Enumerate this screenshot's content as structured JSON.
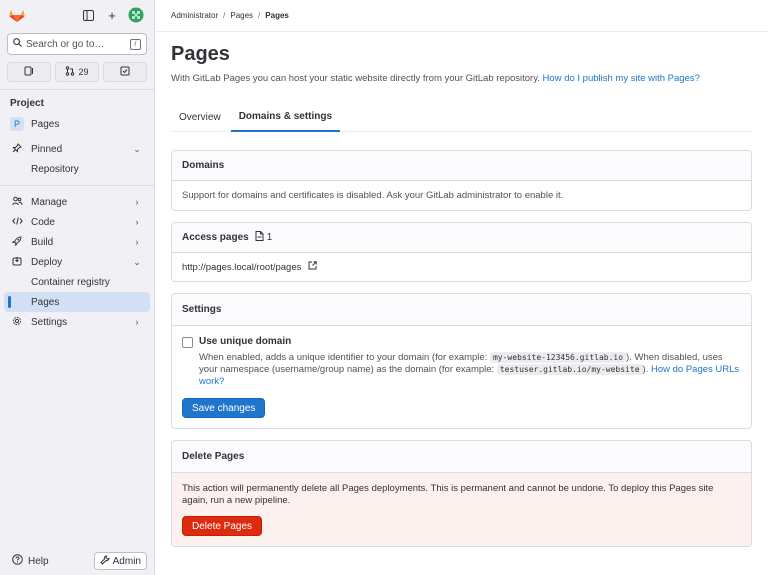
{
  "sidebar": {
    "search_label": "Search or go to…",
    "search_shortcut": "/",
    "merge_requests_count": "29",
    "project_heading": "Project",
    "project_badge": "P",
    "project_name": "Pages",
    "pinned_label": "Pinned",
    "pinned_items": [
      "Repository"
    ],
    "items": [
      {
        "label": "Manage",
        "icon": "users-icon"
      },
      {
        "label": "Code",
        "icon": "code-icon"
      },
      {
        "label": "Build",
        "icon": "rocket-icon"
      },
      {
        "label": "Deploy",
        "icon": "deploy-icon"
      }
    ],
    "deploy_sub": [
      "Container registry",
      "Pages"
    ],
    "settings_label": "Settings",
    "help_label": "Help",
    "admin_label": "Admin"
  },
  "breadcrumb": [
    "Administrator",
    "Pages",
    "Pages"
  ],
  "page": {
    "title": "Pages",
    "description": "With GitLab Pages you can host your static website directly from your GitLab repository.",
    "description_link": "How do I publish my site with Pages?"
  },
  "tabs": [
    "Overview",
    "Domains & settings"
  ],
  "domains": {
    "title": "Domains",
    "body": "Support for domains and certificates is disabled. Ask your GitLab administrator to enable it."
  },
  "access": {
    "title": "Access pages",
    "count": "1",
    "url": "http://pages.local/root/pages"
  },
  "settings": {
    "title": "Settings",
    "checkbox_label": "Use unique domain",
    "help_1": "When enabled, adds a unique identifier to your domain (for example:",
    "code_1": "my-website-123456.gitlab.io",
    "help_2": "). When disabled, uses your namespace (username/group name) as the domain (for example:",
    "code_2": "testuser.gitlab.io/my-website",
    "help_3": ").",
    "help_link": "How do Pages URLs work?",
    "save_label": "Save changes"
  },
  "delete": {
    "title": "Delete Pages",
    "body": "This action will permanently delete all Pages deployments. This is permanent and cannot be undone. To deploy this Pages site again, run a new pipeline.",
    "button_label": "Delete Pages"
  },
  "colors": {
    "accent": "#1f75cb",
    "danger": "#dd2b0e",
    "sidebar_bg": "#f1f0f4",
    "active_bg": "#d1e0f4"
  }
}
